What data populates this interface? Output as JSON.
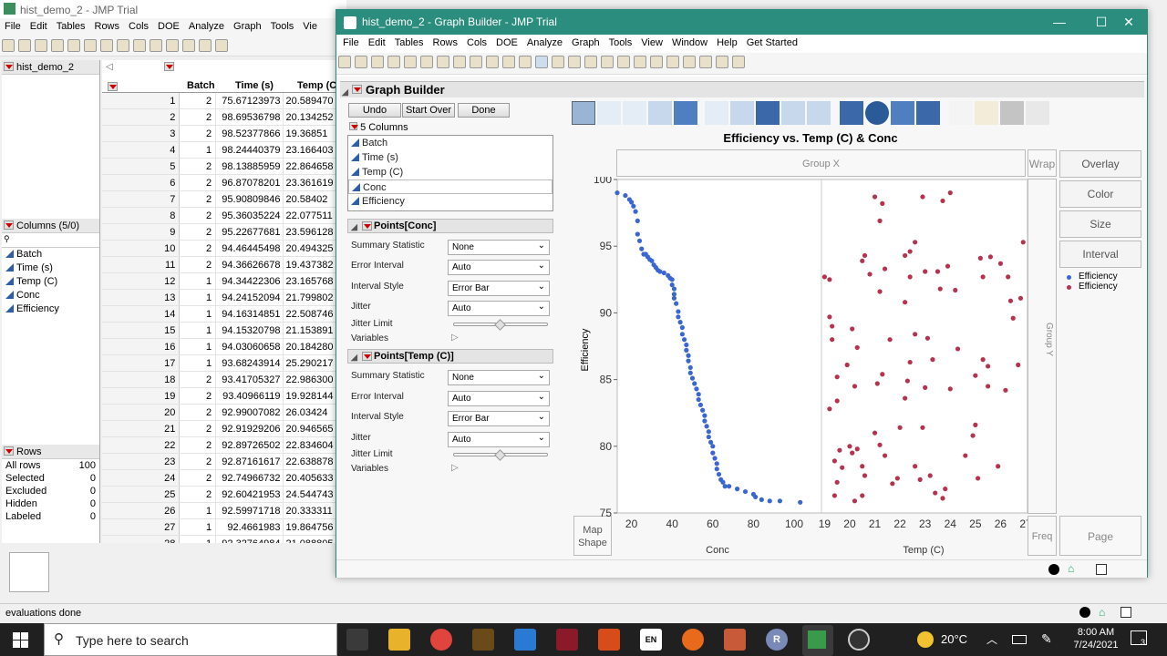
{
  "bg_window": {
    "title": "hist_demo_2 - JMP Trial",
    "menu": [
      "File",
      "Edit",
      "Tables",
      "Rows",
      "Cols",
      "DOE",
      "Analyze",
      "Graph",
      "Tools",
      "Vie"
    ],
    "table_name": "hist_demo_2",
    "columns_header": "Columns (5/0)",
    "columns": [
      "Batch",
      "Time (s)",
      "Temp (C)",
      "Conc",
      "Efficiency"
    ],
    "rows_header": "Rows",
    "row_stats": [
      {
        "label": "All rows",
        "value": "100"
      },
      {
        "label": "Selected",
        "value": "0"
      },
      {
        "label": "Excluded",
        "value": "0"
      },
      {
        "label": "Hidden",
        "value": "0"
      },
      {
        "label": "Labeled",
        "value": "0"
      }
    ],
    "grid_headers": [
      "Batch",
      "Time (s)",
      "Temp (C"
    ],
    "grid_rows": [
      [
        "1",
        "2",
        "75.67123973",
        "20.589470"
      ],
      [
        "2",
        "2",
        "98.69536798",
        "20.134252"
      ],
      [
        "3",
        "2",
        "98.52377866",
        "19.36851"
      ],
      [
        "4",
        "1",
        "98.24440379",
        "23.166403"
      ],
      [
        "5",
        "2",
        "98.13885959",
        "22.864658"
      ],
      [
        "6",
        "2",
        "96.87078201",
        "23.361619"
      ],
      [
        "7",
        "2",
        "95.90809846",
        "20.58402"
      ],
      [
        "8",
        "2",
        "95.36035224",
        "22.077511"
      ],
      [
        "9",
        "2",
        "95.22677681",
        "23.596128"
      ],
      [
        "10",
        "2",
        "94.46445498",
        "20.494325"
      ],
      [
        "11",
        "2",
        "94.36626678",
        "19.437382"
      ],
      [
        "12",
        "1",
        "94.34422306",
        "23.165768"
      ],
      [
        "13",
        "1",
        "94.24152094",
        "21.799802"
      ],
      [
        "14",
        "1",
        "94.16314851",
        "22.508746"
      ],
      [
        "15",
        "1",
        "94.15320798",
        "21.153891"
      ],
      [
        "16",
        "1",
        "94.03060658",
        "20.184280"
      ],
      [
        "17",
        "1",
        "93.68243914",
        "25.290217"
      ],
      [
        "18",
        "2",
        "93.41705327",
        "22.986300"
      ],
      [
        "19",
        "2",
        "93.40966119",
        "19.928144"
      ],
      [
        "20",
        "2",
        "92.99007082",
        "26.03424"
      ],
      [
        "21",
        "2",
        "92.91929206",
        "20.946565"
      ],
      [
        "22",
        "2",
        "92.89726502",
        "22.834604"
      ],
      [
        "23",
        "2",
        "92.87161617",
        "22.638878"
      ],
      [
        "24",
        "2",
        "92.74966732",
        "20.405633"
      ],
      [
        "25",
        "2",
        "92.60421953",
        "24.544743"
      ],
      [
        "26",
        "1",
        "92.59971718",
        "20.333311"
      ],
      [
        "27",
        "1",
        "92.4661983",
        "19.864756"
      ],
      [
        "28",
        "1",
        "92.32764984",
        "21.088805"
      ]
    ],
    "status": "evaluations done"
  },
  "gb_window": {
    "title": "hist_demo_2 - Graph Builder - JMP Trial",
    "menu": [
      "File",
      "Edit",
      "Tables",
      "Rows",
      "Cols",
      "DOE",
      "Analyze",
      "Graph",
      "Tools",
      "View",
      "Window",
      "Help",
      "Get Started"
    ],
    "panel_title": "Graph Builder",
    "buttons": {
      "undo": "Undo",
      "start_over": "Start Over",
      "done": "Done"
    },
    "columns_label": "5 Columns",
    "columns": [
      "Batch",
      "Time (s)",
      "Temp (C)",
      "Conc",
      "Efficiency"
    ],
    "sections": [
      {
        "title": "Points[Conc]",
        "rows": [
          {
            "label": "Summary Statistic",
            "value": "None"
          },
          {
            "label": "Error Interval",
            "value": "Auto"
          },
          {
            "label": "Interval Style",
            "value": "Error Bar"
          },
          {
            "label": "Jitter",
            "value": "Auto"
          }
        ],
        "jitter_limit": "Jitter Limit",
        "variables": "Variables"
      },
      {
        "title": "Points[Temp (C)]",
        "rows": [
          {
            "label": "Summary Statistic",
            "value": "None"
          },
          {
            "label": "Error Interval",
            "value": "Auto"
          },
          {
            "label": "Interval Style",
            "value": "Error Bar"
          },
          {
            "label": "Jitter",
            "value": "Auto"
          }
        ],
        "jitter_limit": "Jitter Limit",
        "variables": "Variables"
      }
    ],
    "graph_title": "Efficiency vs. Temp (C) & Conc",
    "zones": {
      "group_x": "Group X",
      "group_y": "Group Y",
      "wrap": "Wrap",
      "overlay": "Overlay",
      "color": "Color",
      "size": "Size",
      "interval": "Interval",
      "freq": "Freq",
      "page": "Page",
      "map_shape": "Map Shape"
    },
    "legend": [
      {
        "label": "Efficiency",
        "color": "#3a66d4"
      },
      {
        "label": "Efficiency",
        "color": "#b5334f"
      }
    ]
  },
  "chart_data": {
    "type": "scatter",
    "title": "Efficiency vs. Temp (C) & Conc",
    "ylabel": "Efficiency",
    "ylim": [
      75,
      100
    ],
    "yticks": [
      75,
      80,
      85,
      90,
      95,
      100
    ],
    "panels": [
      {
        "xlabel": "Conc",
        "xlim": [
          13,
          113
        ],
        "xticks": [
          20,
          40,
          60,
          80,
          100
        ],
        "color": "#3a66d4",
        "points": [
          [
            13,
            99
          ],
          [
            17,
            98.8
          ],
          [
            19,
            98.5
          ],
          [
            20,
            98.3
          ],
          [
            21,
            98
          ],
          [
            22,
            97.6
          ],
          [
            23,
            96.9
          ],
          [
            23,
            95.9
          ],
          [
            24,
            95.4
          ],
          [
            25,
            94.8
          ],
          [
            26,
            94.4
          ],
          [
            27,
            94.4
          ],
          [
            28,
            94.2
          ],
          [
            29,
            94
          ],
          [
            30,
            93.9
          ],
          [
            31,
            93.6
          ],
          [
            32,
            93.4
          ],
          [
            33,
            93.2
          ],
          [
            34,
            93.1
          ],
          [
            36,
            93
          ],
          [
            38,
            92.8
          ],
          [
            39,
            92.6
          ],
          [
            40,
            92.5
          ],
          [
            40,
            92.1
          ],
          [
            41,
            91.8
          ],
          [
            41,
            91.4
          ],
          [
            41,
            91.1
          ],
          [
            42,
            90.7
          ],
          [
            43,
            90.1
          ],
          [
            43,
            89.7
          ],
          [
            44,
            89.3
          ],
          [
            45,
            88.9
          ],
          [
            45,
            88.4
          ],
          [
            46,
            88
          ],
          [
            47,
            87.6
          ],
          [
            47,
            87.2
          ],
          [
            48,
            86.8
          ],
          [
            48,
            86.4
          ],
          [
            49,
            85.9
          ],
          [
            49,
            85.5
          ],
          [
            50,
            85.1
          ],
          [
            51,
            84.7
          ],
          [
            52,
            84.3
          ],
          [
            53,
            83.9
          ],
          [
            53,
            83.5
          ],
          [
            54,
            83.1
          ],
          [
            55,
            82.7
          ],
          [
            56,
            82.3
          ],
          [
            56,
            81.9
          ],
          [
            57,
            81.5
          ],
          [
            58,
            81.1
          ],
          [
            58,
            80.7
          ],
          [
            59,
            80.3
          ],
          [
            60,
            80
          ],
          [
            60,
            79.5
          ],
          [
            61,
            79.1
          ],
          [
            62,
            78.7
          ],
          [
            62,
            78.3
          ],
          [
            63,
            77.9
          ],
          [
            64,
            77.5
          ],
          [
            65,
            77.3
          ],
          [
            66,
            77
          ],
          [
            68,
            77
          ],
          [
            72,
            76.8
          ],
          [
            76,
            76.6
          ],
          [
            80,
            76.4
          ],
          [
            81,
            76.2
          ],
          [
            84,
            76
          ],
          [
            88,
            75.9
          ],
          [
            93,
            75.9
          ],
          [
            103,
            75.8
          ]
        ]
      },
      {
        "xlabel": "Temp (C)",
        "xlim": [
          18.95,
          27
        ],
        "xticks": [
          19,
          20,
          21,
          22,
          23,
          24,
          25,
          26,
          27
        ],
        "color": "#b5334f",
        "points": [
          [
            19.0,
            92.7
          ],
          [
            19.2,
            92.5
          ],
          [
            19.2,
            89.7
          ],
          [
            19.3,
            89
          ],
          [
            19.3,
            88
          ],
          [
            19.5,
            85.2
          ],
          [
            19.5,
            83.4
          ],
          [
            19.2,
            82.8
          ],
          [
            19.6,
            79.7
          ],
          [
            19.4,
            78.9
          ],
          [
            19.5,
            77.3
          ],
          [
            19.4,
            76.3
          ],
          [
            19.7,
            78.4
          ],
          [
            19.9,
            86.1
          ],
          [
            20.1,
            88.8
          ],
          [
            20.3,
            87.4
          ],
          [
            20.2,
            84.5
          ],
          [
            20.0,
            80
          ],
          [
            20.1,
            79.5
          ],
          [
            20.3,
            79.8
          ],
          [
            20.5,
            78.5
          ],
          [
            20.5,
            76.3
          ],
          [
            20.6,
            77.8
          ],
          [
            20.2,
            75.9
          ],
          [
            20.5,
            93.9
          ],
          [
            20.6,
            94.3
          ],
          [
            20.8,
            92.9
          ],
          [
            21.0,
            98.7
          ],
          [
            21.3,
            98.2
          ],
          [
            21.2,
            96.9
          ],
          [
            21.4,
            93.3
          ],
          [
            21.2,
            91.6
          ],
          [
            21.6,
            88
          ],
          [
            21.3,
            85.4
          ],
          [
            21.1,
            84.7
          ],
          [
            21.0,
            81
          ],
          [
            21.2,
            80.1
          ],
          [
            21.4,
            79.3
          ],
          [
            21.7,
            77.2
          ],
          [
            21.9,
            77.6
          ],
          [
            22.0,
            81.4
          ],
          [
            22.2,
            83.6
          ],
          [
            22.3,
            84.9
          ],
          [
            22.4,
            86.3
          ],
          [
            22.6,
            88.4
          ],
          [
            22.2,
            90.8
          ],
          [
            22.4,
            92.7
          ],
          [
            22.2,
            94.3
          ],
          [
            22.4,
            94.6
          ],
          [
            22.6,
            95.3
          ],
          [
            22.9,
            98.7
          ],
          [
            23.0,
            93.1
          ],
          [
            23.1,
            88.1
          ],
          [
            23.3,
            86.5
          ],
          [
            23.0,
            84.4
          ],
          [
            22.9,
            81.4
          ],
          [
            22.6,
            78.5
          ],
          [
            22.8,
            77.5
          ],
          [
            23.2,
            77.8
          ],
          [
            23.4,
            76.5
          ],
          [
            23.7,
            76.1
          ],
          [
            23.8,
            76.8
          ],
          [
            23.5,
            93.1
          ],
          [
            23.6,
            91.8
          ],
          [
            23.7,
            98.4
          ],
          [
            24.0,
            99
          ],
          [
            23.9,
            93.5
          ],
          [
            24.2,
            91.7
          ],
          [
            24.0,
            84.3
          ],
          [
            24.3,
            87.3
          ],
          [
            24.6,
            79.3
          ],
          [
            24.9,
            80.8
          ],
          [
            25.0,
            85.3
          ],
          [
            25.2,
            94.1
          ],
          [
            25.3,
            92.7
          ],
          [
            25.3,
            86.5
          ],
          [
            25.5,
            86
          ],
          [
            25.5,
            84.5
          ],
          [
            25.6,
            94.2
          ],
          [
            25.0,
            81.6
          ],
          [
            25.1,
            77.6
          ],
          [
            26.0,
            93.7
          ],
          [
            26.3,
            92.7
          ],
          [
            26.4,
            90.9
          ],
          [
            26.5,
            89.6
          ],
          [
            26.7,
            86.1
          ],
          [
            26.8,
            91.1
          ],
          [
            26.9,
            95.3
          ],
          [
            25.9,
            78.5
          ],
          [
            26.2,
            84.2
          ]
        ]
      }
    ]
  },
  "taskbar": {
    "search_placeholder": "Type here to search",
    "weather": "20°C",
    "time": "8:00 AM",
    "date": "7/24/2021",
    "notif_count": "3"
  }
}
